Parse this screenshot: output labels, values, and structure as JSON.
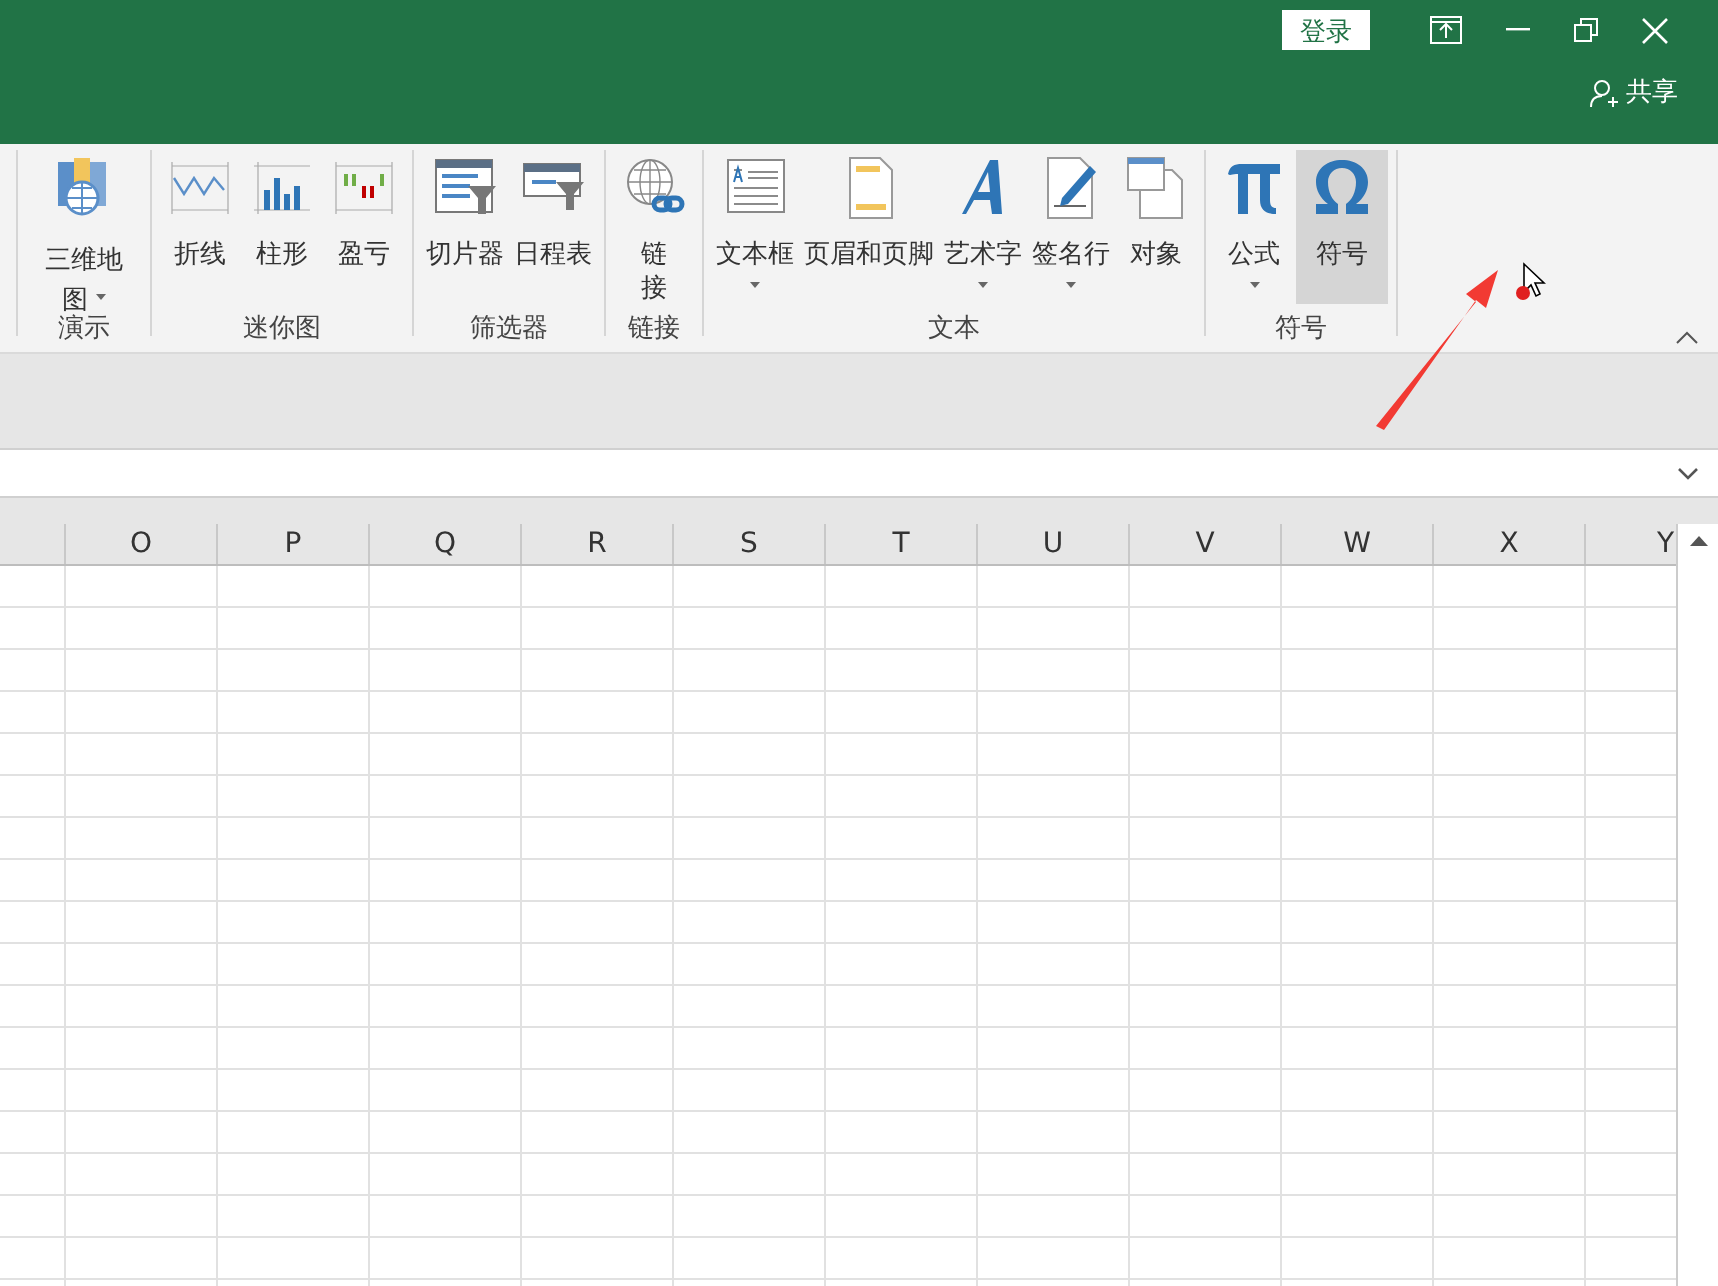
{
  "title_bar": {
    "login_button": "登录",
    "share_button": "共享"
  },
  "ribbon": {
    "groups": [
      {
        "label": "演示",
        "buttons": [
          {
            "label": "三维地图",
            "kind": "map3d",
            "dropdown": true,
            "selected": false
          }
        ]
      },
      {
        "label": "迷你图",
        "buttons": [
          {
            "label": "折线",
            "kind": "sparkline",
            "dropdown": false,
            "selected": false
          },
          {
            "label": "柱形",
            "kind": "sparkcolumn",
            "dropdown": false,
            "selected": false
          },
          {
            "label": "盈亏",
            "kind": "winloss",
            "dropdown": false,
            "selected": false
          }
        ]
      },
      {
        "label": "筛选器",
        "buttons": [
          {
            "label": "切片器",
            "kind": "slicer",
            "dropdown": false,
            "selected": false
          },
          {
            "label": "日程表",
            "kind": "timeline",
            "dropdown": false,
            "selected": false
          }
        ]
      },
      {
        "label": "链接",
        "buttons": [
          {
            "label": "链接",
            "kind": "link",
            "dropdown": false,
            "selected": false
          }
        ]
      },
      {
        "label": "文本",
        "buttons": [
          {
            "label": "文本框",
            "kind": "textbox",
            "dropdown": true,
            "selected": false
          },
          {
            "label": "页眉和页脚",
            "kind": "header",
            "dropdown": false,
            "selected": false
          },
          {
            "label": "艺术字",
            "kind": "wordart",
            "dropdown": true,
            "selected": false
          },
          {
            "label": "签名行",
            "kind": "signature",
            "dropdown": true,
            "selected": false
          },
          {
            "label": "对象",
            "kind": "object",
            "dropdown": false,
            "selected": false
          }
        ]
      },
      {
        "label": "符号",
        "buttons": [
          {
            "label": "公式",
            "kind": "equation",
            "dropdown": true,
            "selected": false
          },
          {
            "label": "符号",
            "kind": "symbol",
            "dropdown": false,
            "selected": true
          }
        ]
      }
    ]
  },
  "sheet": {
    "columns": [
      "O",
      "P",
      "Q",
      "R",
      "S",
      "T",
      "U",
      "V",
      "W",
      "X",
      "Y"
    ]
  }
}
